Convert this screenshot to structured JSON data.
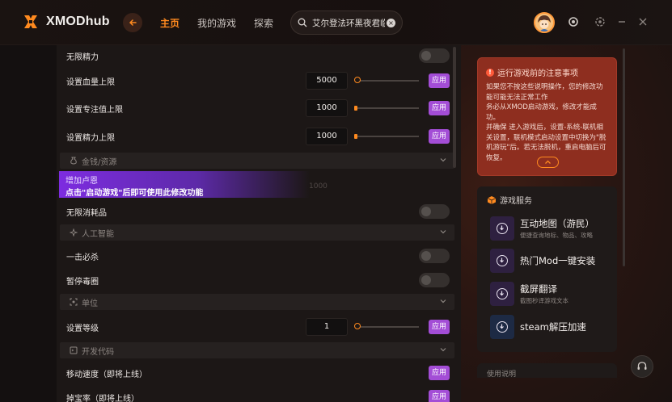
{
  "app": {
    "logo_text": "XMODhub",
    "nav": [
      "主页",
      "我的游戏",
      "探索"
    ],
    "search_value": "艾尔登法环黑夜君临"
  },
  "colors": {
    "accent": "#ff8a1f",
    "apply": "#a34dd6",
    "notice": "#8e2e1f"
  },
  "rows": {
    "unlimited_stamina": "无限精力",
    "hp_limit": {
      "label": "设置血量上限",
      "value": "5000",
      "apply": "应用"
    },
    "focus_limit": {
      "label": "设置专注值上限",
      "value": "1000",
      "apply": "应用"
    },
    "stamina_limit": {
      "label": "设置精力上限",
      "value": "1000",
      "apply": "应用"
    },
    "unlimited_consumables": "无限消耗品",
    "one_hit": "一击必杀",
    "pause_circle": "暂停毒圈",
    "level": {
      "label": "设置等级",
      "value": "1",
      "apply": "应用"
    },
    "move_speed": {
      "label": "移动速度（即将上线）",
      "apply": "应用"
    },
    "drop_rate": {
      "label": "掉宝率（即将上线）",
      "apply": "应用"
    }
  },
  "sections": {
    "money": "金钱/资源",
    "ai": "人工智能",
    "unit": "单位",
    "dev": "开发代码"
  },
  "promo": {
    "line1": "增加卢恩",
    "line2": "点击\"启动游戏\"后即可使用此修改功能",
    "ghost_value": "1000"
  },
  "notice": {
    "title": "运行游戏前的注意事项",
    "body": "如果您不按这些说明操作，您的修改功能可能无法正常工作\n务必从XMOD启动游戏，修改才能成功。\n并确保 进入游戏后，设置-系统-联机相关设置，联机模式启动设置中切换为\"脱机游玩\"后。若无法脱机，重启电脑后可恢复。"
  },
  "services": {
    "title": "游戏服务",
    "items": [
      {
        "title": "互动地图（游民）",
        "sub": "便捷查询地标、物品、攻略"
      },
      {
        "title": "热门Mod一键安装",
        "sub": ""
      },
      {
        "title": "截屏翻译",
        "sub": "截图秒译游戏文本"
      },
      {
        "title": "steam解压加速",
        "sub": ""
      }
    ]
  },
  "usage_title": "使用说明"
}
